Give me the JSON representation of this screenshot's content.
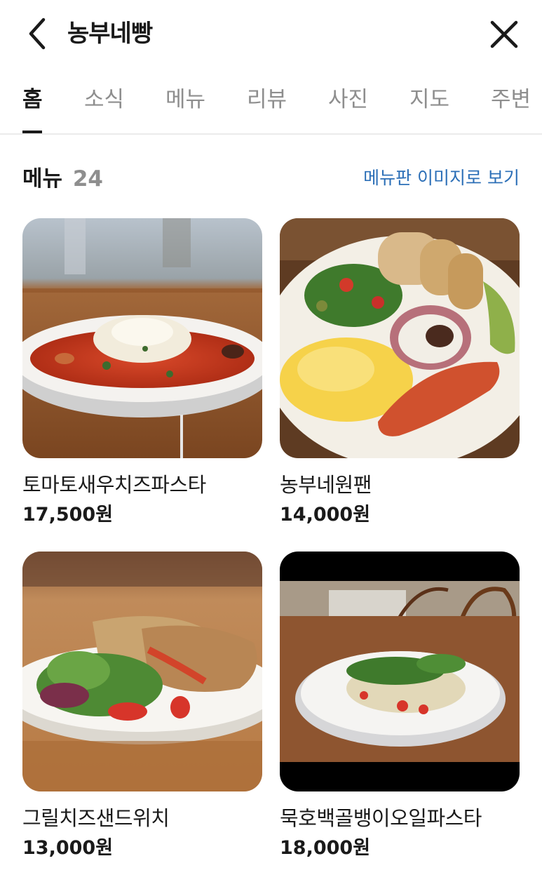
{
  "header": {
    "title": "농부네빵",
    "back_icon": "chevron-left-icon",
    "close_icon": "close-icon"
  },
  "tabs": [
    {
      "label": "홈",
      "active": true
    },
    {
      "label": "소식",
      "active": false
    },
    {
      "label": "메뉴",
      "active": false
    },
    {
      "label": "리뷰",
      "active": false
    },
    {
      "label": "사진",
      "active": false
    },
    {
      "label": "지도",
      "active": false
    },
    {
      "label": "주변",
      "active": false
    }
  ],
  "menu_section": {
    "title": "메뉴",
    "count": "24",
    "menu_board_link": "메뉴판 이미지로 보기",
    "items": [
      {
        "name": "토마토새우치즈파스타",
        "price": "17,500원"
      },
      {
        "name": "농부네원팬",
        "price": "14,000원"
      },
      {
        "name": "그릴치즈샌드위치",
        "price": "13,000원"
      },
      {
        "name": "묵호백골뱅이오일파스타",
        "price": "18,000원"
      }
    ]
  },
  "colors": {
    "text": "#1a1a1a",
    "tab_inactive": "#8e8e8e",
    "link": "#2c6fb7"
  }
}
